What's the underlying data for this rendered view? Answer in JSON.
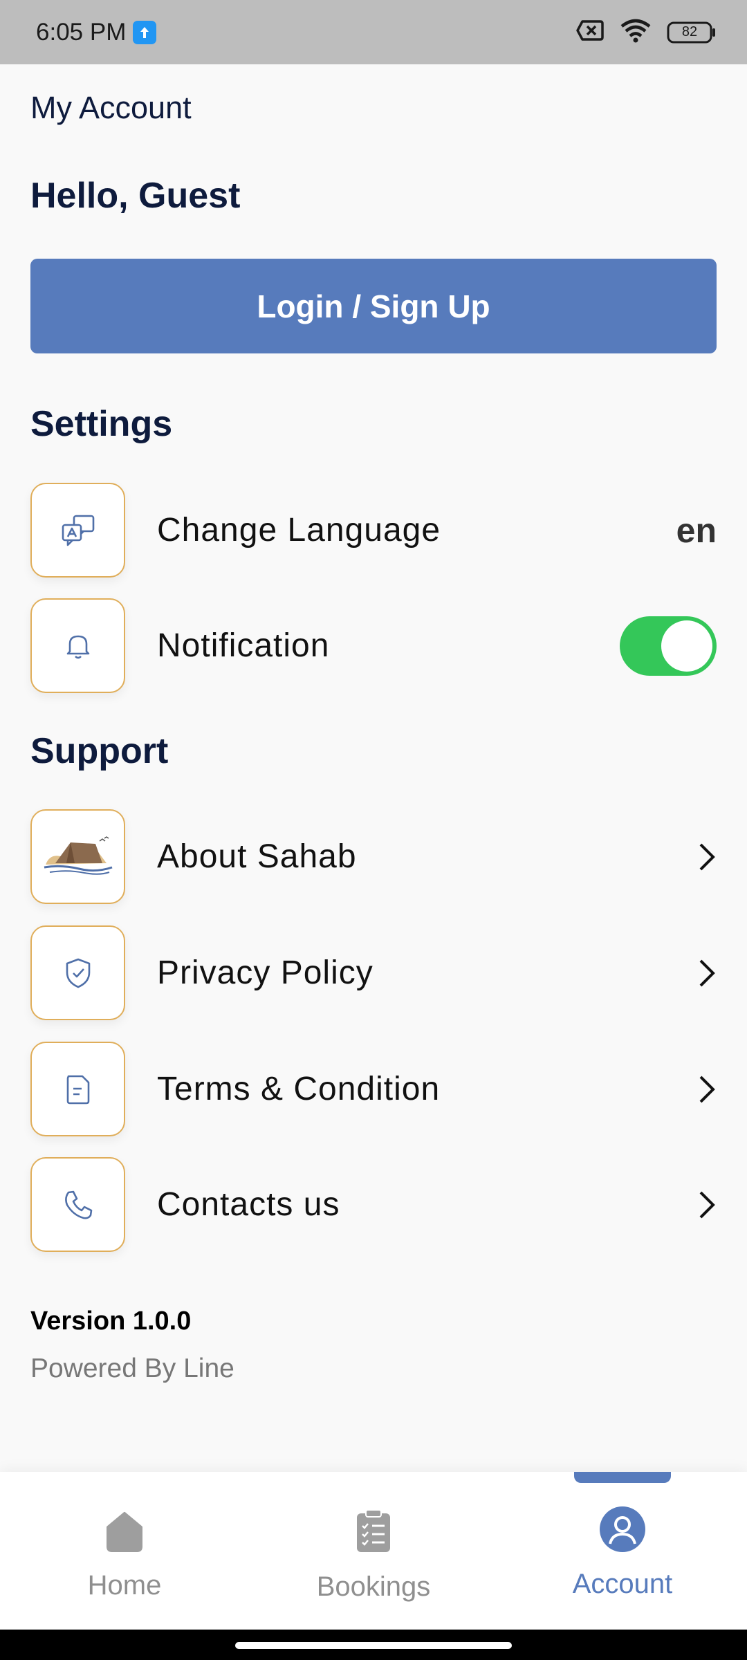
{
  "status_bar": {
    "time": "6:05 PM",
    "battery": "82",
    "icons": [
      "upload-icon",
      "sim-off-icon",
      "wifi-icon",
      "battery-icon"
    ]
  },
  "header": {
    "title": "My Account",
    "greeting": "Hello, Guest"
  },
  "login_button": {
    "label": "Login / Sign Up"
  },
  "settings": {
    "title": "Settings",
    "items": [
      {
        "label": "Change Language",
        "value": "en",
        "icon": "translate-icon"
      },
      {
        "label": "Notification",
        "toggle_on": true,
        "icon": "bell-icon"
      }
    ]
  },
  "support": {
    "title": "Support",
    "items": [
      {
        "label": "About Sahab",
        "icon": "sahab-logo-icon"
      },
      {
        "label": "Privacy Policy",
        "icon": "shield-check-icon"
      },
      {
        "label": "Terms & Condition",
        "icon": "document-icon"
      },
      {
        "label": "Contacts us",
        "icon": "phone-icon"
      }
    ]
  },
  "footer": {
    "version": "Version 1.0.0",
    "powered_by": "Powered By Line"
  },
  "bottom_nav": {
    "items": [
      {
        "label": "Home",
        "active": false
      },
      {
        "label": "Bookings",
        "active": false
      },
      {
        "label": "Account",
        "active": true
      }
    ]
  },
  "colors": {
    "accent": "#577bbc",
    "icon_border": "#e0ae5a",
    "toggle_on": "#34c759",
    "text_dark": "#0e1b3d"
  }
}
